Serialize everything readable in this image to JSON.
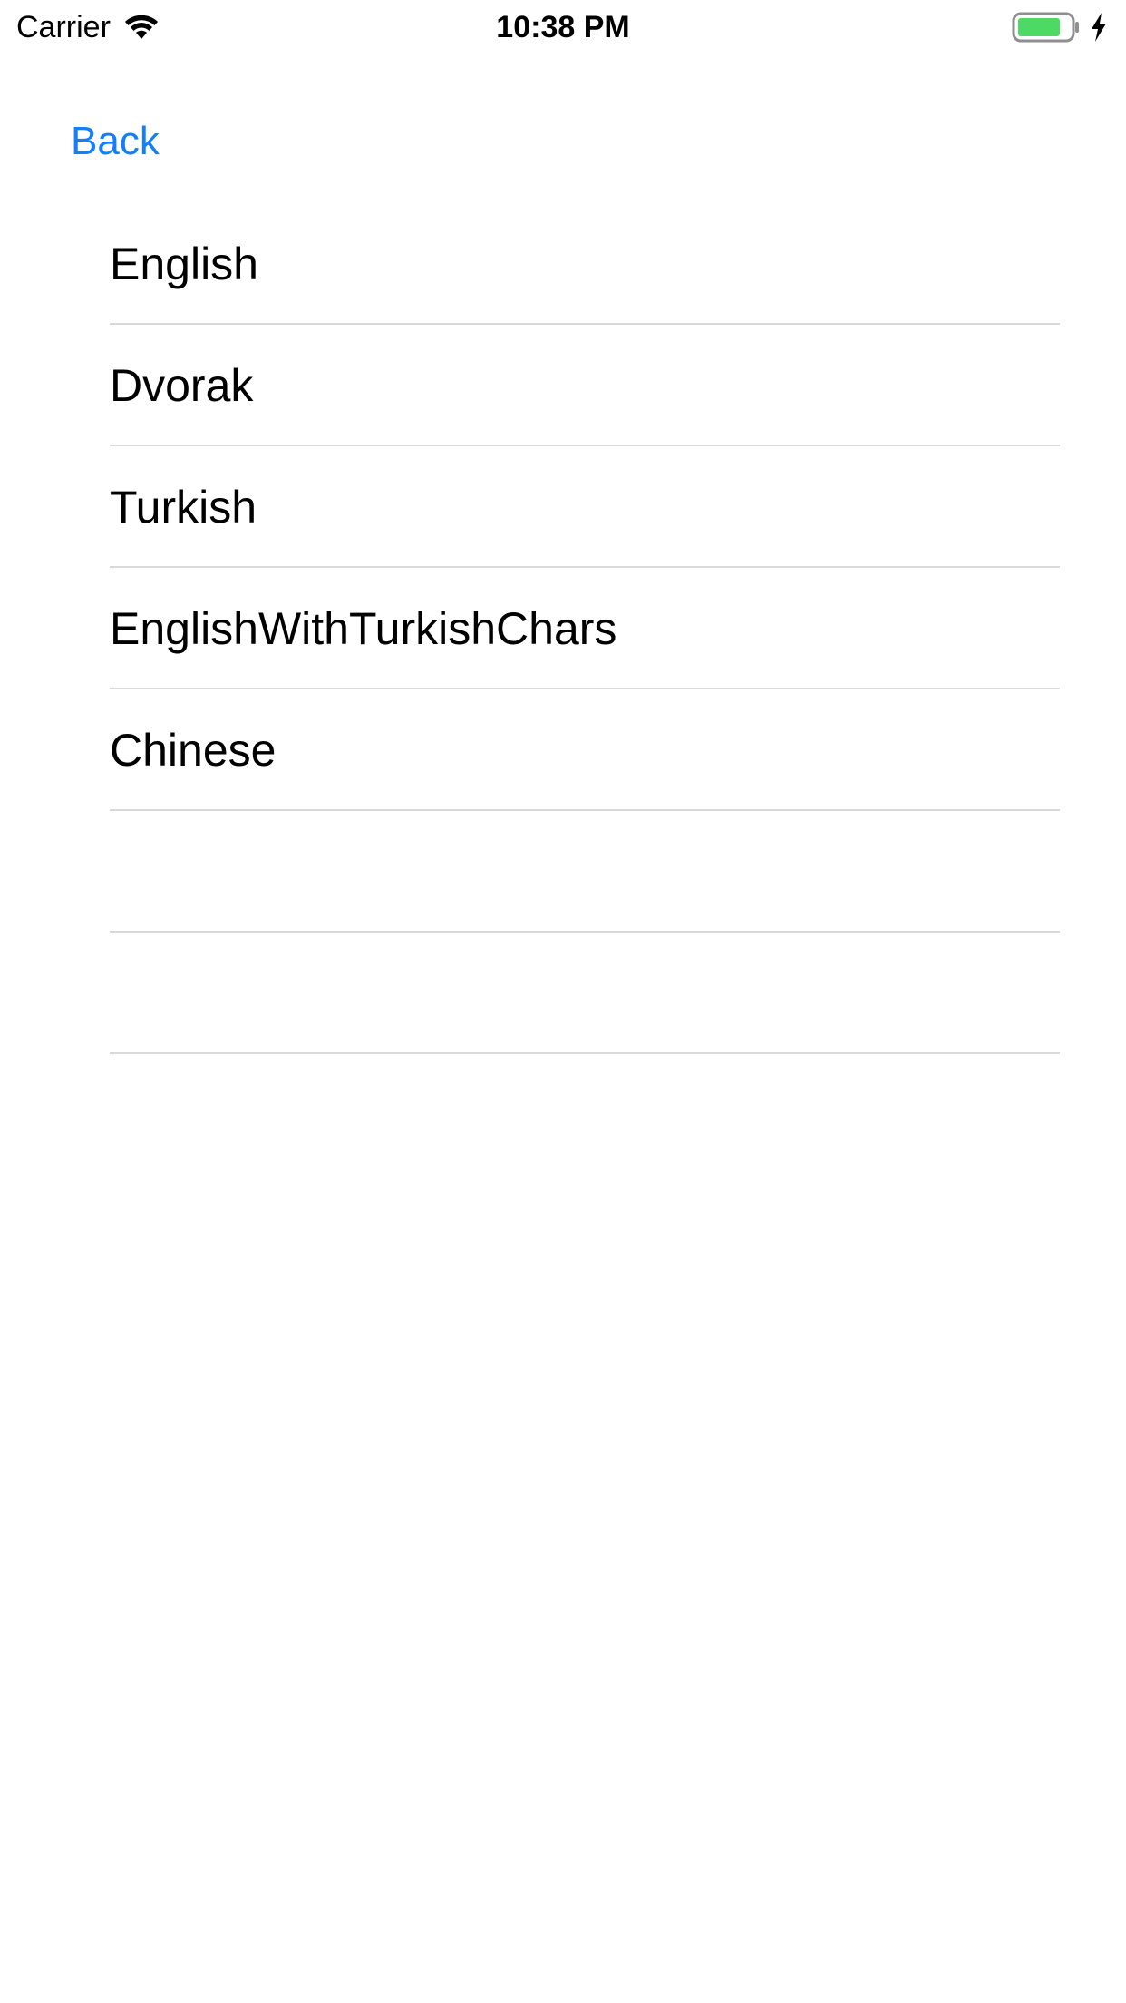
{
  "status_bar": {
    "carrier": "Carrier",
    "time": "10:38 PM",
    "wifi_icon": "wifi-icon",
    "battery_icon": "battery-icon",
    "charging_icon": "bolt-icon",
    "battery_color": "#4cd964"
  },
  "nav": {
    "back_label": "Back",
    "accent_color": "#147EFB"
  },
  "list": {
    "items": [
      {
        "label": "English"
      },
      {
        "label": "Dvorak"
      },
      {
        "label": "Turkish"
      },
      {
        "label": "EnglishWithTurkishChars"
      },
      {
        "label": "Chinese"
      },
      {
        "label": ""
      },
      {
        "label": ""
      }
    ]
  }
}
